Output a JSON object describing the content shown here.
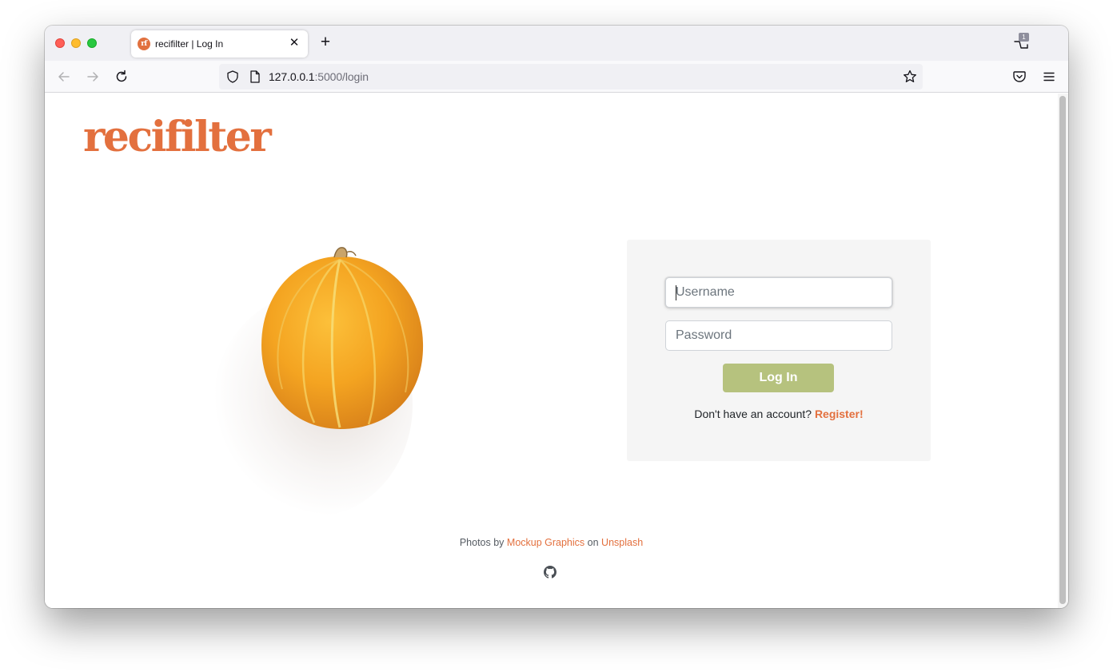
{
  "browser": {
    "tab_title": "recifilter | Log In",
    "tab_favicon_text": "rf",
    "tab_close": "✕",
    "new_tab": "+",
    "notification_count": "1",
    "url_host": "127.0.0.1",
    "url_rest": ":5000/login"
  },
  "site": {
    "logo": "recifilter"
  },
  "login": {
    "username_placeholder": "Username",
    "password_placeholder": "Password",
    "button_label": "Log In",
    "register_prompt": "Don't have an account?",
    "register_link": "Register!"
  },
  "footer": {
    "photos_by": "Photos by",
    "photographer": "Mockup Graphics",
    "on": "on",
    "source": "Unsplash"
  },
  "colors": {
    "brand": "#e3703e",
    "button": "#b6c27e",
    "card_bg": "#f5f5f5"
  },
  "icons": [
    "back-arrow-icon",
    "forward-arrow-icon",
    "reload-icon",
    "shield-icon",
    "page-icon",
    "star-icon",
    "pocket-icon",
    "hamburger-menu-icon",
    "github-icon"
  ]
}
